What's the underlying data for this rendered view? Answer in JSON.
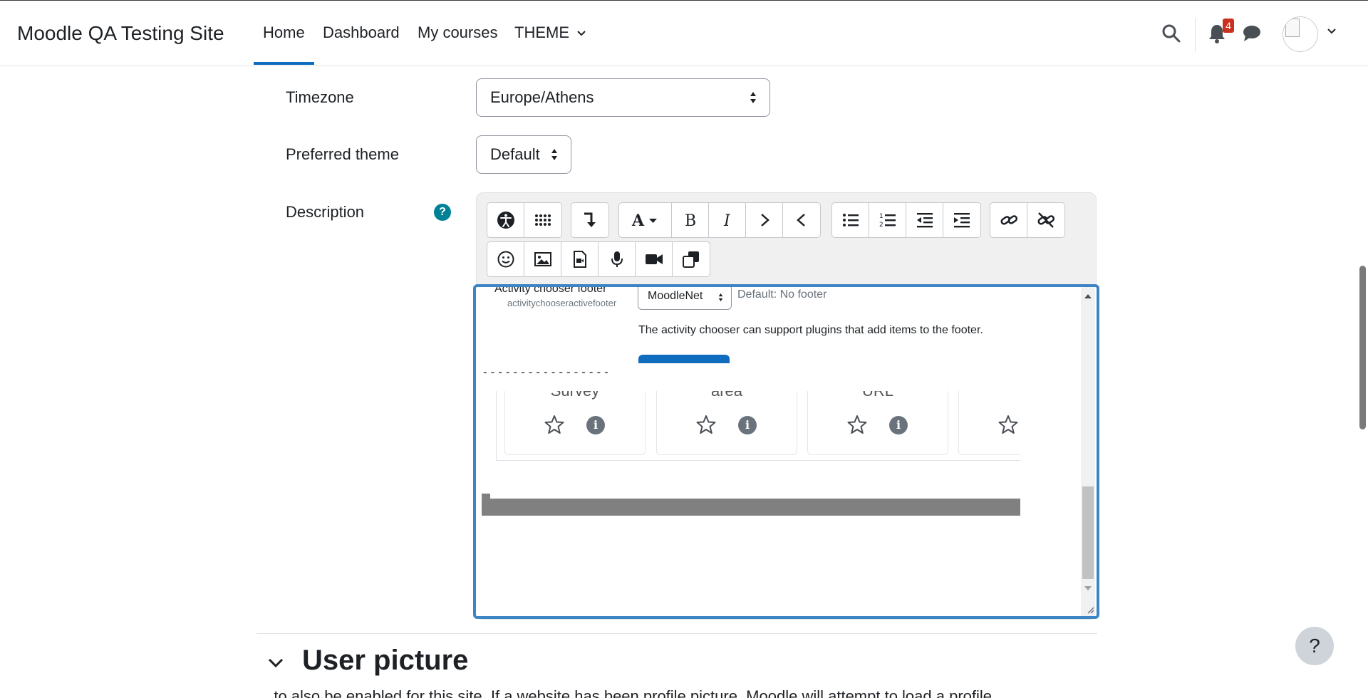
{
  "navbar": {
    "site_name": "Moodle QA Testing Site",
    "links": {
      "home": "Home",
      "dashboard": "Dashboard",
      "my_courses": "My courses",
      "theme": "THEME"
    },
    "active_link": "Home",
    "notification_count": "4"
  },
  "form": {
    "timezone": {
      "label": "Timezone",
      "value": "Europe/Athens"
    },
    "preferred_theme": {
      "label": "Preferred theme",
      "value": "Default"
    },
    "description": {
      "label": "Description",
      "help": "?"
    }
  },
  "editor_content": {
    "footer_label": "Activity chooser footer",
    "footer_key": "activitychooseractivefooter",
    "footer_select": "MoodleNet",
    "footer_default": "Default: No footer",
    "footer_help": "The activity chooser can support plugins that add items to the footer.",
    "divider": "-----------------",
    "cards": [
      {
        "title": "Survey"
      },
      {
        "title": "area"
      },
      {
        "title": "URL"
      }
    ]
  },
  "section": {
    "title": "User picture",
    "subtitle": "...to also be enabled for this site. If a website has been profile picture, Moodle will attempt to load a profile"
  },
  "help_button": "?",
  "colors": {
    "accent": "#0f6cbf",
    "badge": "#ca3120",
    "help_icon": "#008196",
    "editor_focus": "#3d86c6"
  }
}
